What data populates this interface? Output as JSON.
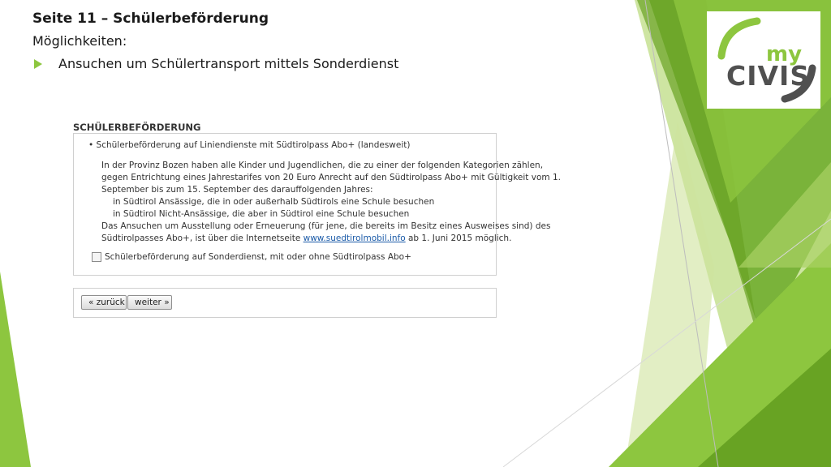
{
  "slide": {
    "title": "Seite 11 – Schülerbeförderung",
    "subtitle": "Möglichkeiten:",
    "bullet": "Ansuchen um Schülertransport mittels Sonderdienst"
  },
  "logo": {
    "small": "my",
    "large": "CIVIS"
  },
  "form": {
    "title": "SCHÜLERBEFÖRDERUNG",
    "option_1": "• Schülerbeförderung auf Liniendienste mit Südtirolpass Abo+ (landesweit)",
    "info_lines": [
      "In der Provinz Bozen haben alle Kinder und Jugendlichen, die zu einer der folgenden Kategorien zählen,",
      "gegen Entrichtung eines Jahrestarifes von 20 Euro Anrecht auf den Südtirolpass Abo+ mit Gültigkeit vom 1.",
      "September bis zum 15. September des darauffolgenden Jahres:",
      "in Südtirol Ansässige, die in oder außerhalb Südtirols eine Schule besuchen",
      "in Südtirol Nicht-Ansässige, die aber in Südtirol eine Schule besuchen",
      "Das Ansuchen um Ausstellung oder Erneuerung (für jene, die bereits im Besitz eines Ausweises sind) des"
    ],
    "info_last_prefix": "Südtirolpasses Abo+, ist über die Internetseite ",
    "info_link": "www.suedtirolmobil.info",
    "info_last_suffix": " ab 1. Juni 2015 möglich.",
    "option_2": "Schülerbeförderung auf Sonderdienst, mit oder ohne Südtirolpass Abo+",
    "back_label": "« zurück",
    "next_label": "weiter »"
  },
  "colors": {
    "accent_green": "#8dc63f",
    "dark_green": "#6aa323",
    "logo_gray": "#505050",
    "link_blue": "#1a5aa8"
  }
}
